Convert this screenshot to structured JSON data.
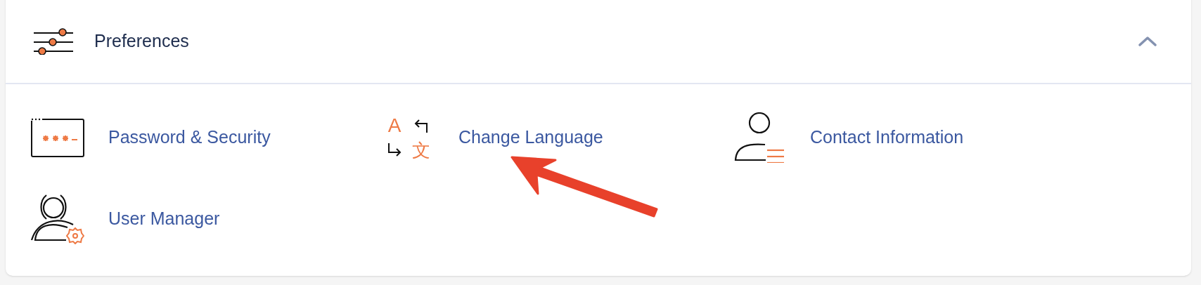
{
  "panel": {
    "title": "Preferences",
    "expanded": true,
    "items": [
      {
        "kind": "password",
        "label": "Password & Security"
      },
      {
        "kind": "language",
        "label": "Change Language",
        "glyphs": [
          "A",
          "文"
        ]
      },
      {
        "kind": "contact",
        "label": "Contact Information"
      },
      {
        "kind": "users",
        "label": "User Manager"
      }
    ]
  }
}
